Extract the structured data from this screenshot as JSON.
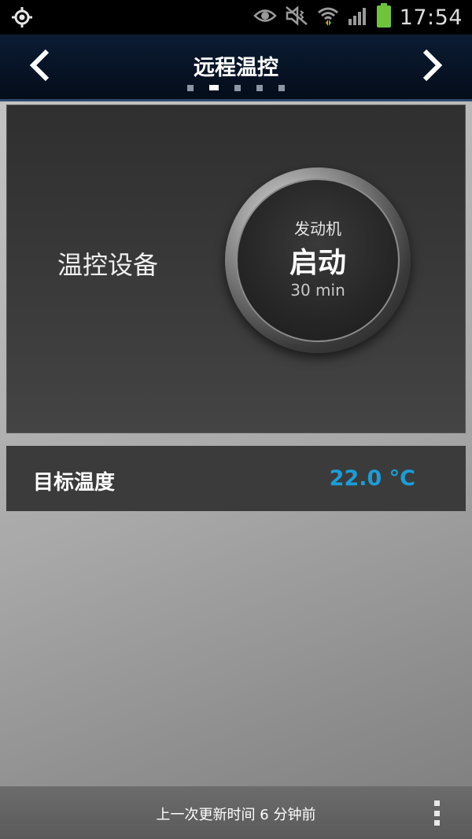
{
  "status_bar": {
    "time": "17:54",
    "icons": [
      "gps-icon",
      "eye-icon",
      "mute-icon",
      "wifi-icon",
      "signal-icon",
      "battery-icon"
    ]
  },
  "header": {
    "title": "远程温控",
    "page_count": 5,
    "active_page": 2
  },
  "device": {
    "label": "温控设备",
    "engine_button": {
      "top_label": "发动机",
      "action_label": "启动",
      "duration": "30 min"
    }
  },
  "target_temperature": {
    "label": "目标温度",
    "value": "22.0 °C",
    "value_color": "#1a9ed8"
  },
  "footer": {
    "last_update": "上一次更新时间 6 分钟前"
  }
}
